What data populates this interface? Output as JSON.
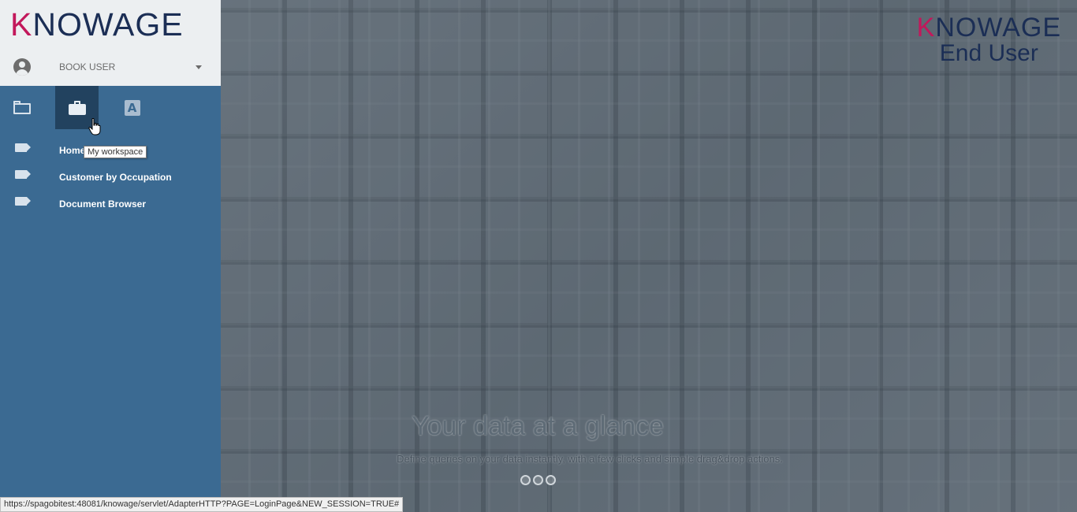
{
  "sidebar": {
    "logo": {
      "first_letter": "K",
      "rest": "NOWAGE"
    },
    "user": {
      "name": "BOOK USER"
    },
    "tabs": [
      {
        "name": "folder",
        "icon": "folder-icon",
        "active": false
      },
      {
        "name": "my-workspace",
        "icon": "briefcase-icon",
        "active": true
      },
      {
        "name": "font",
        "icon": "font-icon",
        "glyph": "A",
        "active": false
      }
    ],
    "items": [
      {
        "label": "Homepage",
        "icon": "tag-icon"
      },
      {
        "label": "Customer by Occupation",
        "icon": "tag-icon"
      },
      {
        "label": "Document Browser",
        "icon": "tag-icon"
      }
    ],
    "tooltip": "My workspace"
  },
  "main": {
    "brand": {
      "first_letter": "K",
      "rest": "NOWAGE",
      "subtitle": "End User"
    },
    "headline": "Your data at a glance",
    "subline": "Define queries on your data instantly, with a few clicks and simple drag&drop actions."
  },
  "statusbar": {
    "url": "https://spagobitest:48081/knowage/servlet/AdapterHTTP?PAGE=LoginPage&NEW_SESSION=TRUE#"
  },
  "colors": {
    "sidebar": "#3b6a92",
    "active_tab": "#22425f",
    "brand_navy": "#1b2e55",
    "brand_accent": "#c2185b"
  }
}
